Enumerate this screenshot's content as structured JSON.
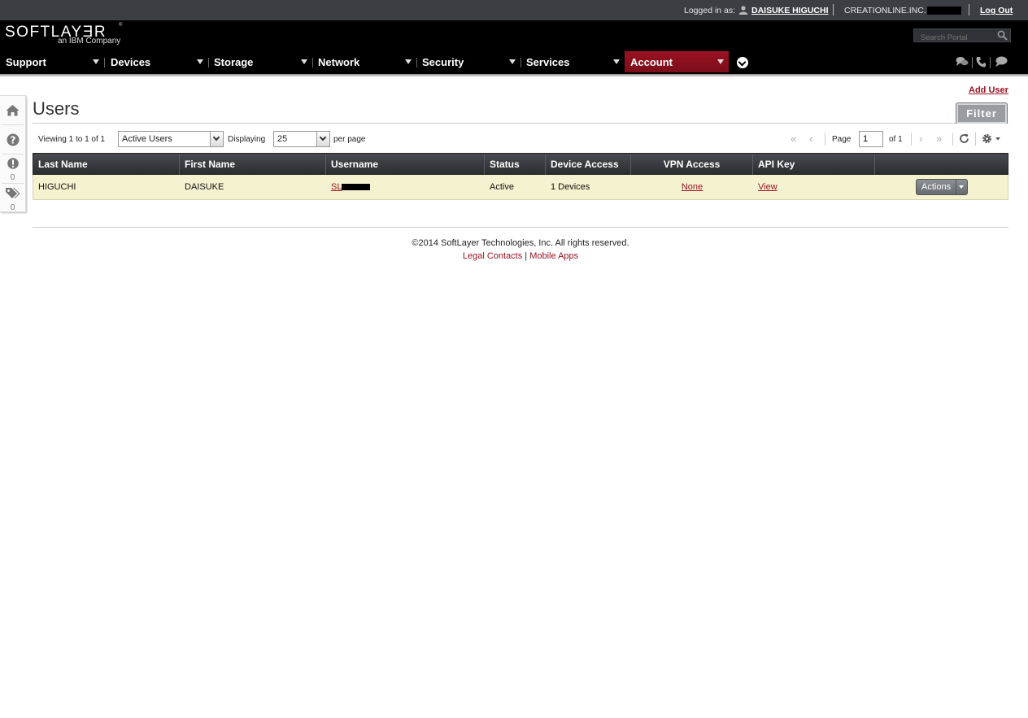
{
  "topbar": {
    "logged_in_label": "Logged in as:",
    "user_name": "DAISUKE HIGUCHI",
    "company": "CREATIONLINE.INC.",
    "logout": "Log Out"
  },
  "brand": {
    "logo": "SOFTLAYƎR",
    "tagline": "an IBM Company",
    "registered": "®"
  },
  "search": {
    "placeholder": "Search Portal"
  },
  "nav": {
    "tabs": [
      {
        "label": "Support"
      },
      {
        "label": "Devices"
      },
      {
        "label": "Storage"
      },
      {
        "label": "Network"
      },
      {
        "label": "Security"
      },
      {
        "label": "Services"
      },
      {
        "label": "Account",
        "active": true
      }
    ],
    "active_color": "#9b1222"
  },
  "side": {
    "alerts_count": "0",
    "tags_count": "0"
  },
  "page": {
    "title": "Users",
    "add_user": "Add User",
    "filter": "Filter"
  },
  "controls": {
    "viewing": "Viewing 1 to 1 of 1",
    "status_filter": "Active Users",
    "displaying": "Displaying",
    "per_page_value": "25",
    "per_page": "per page",
    "page_label": "Page",
    "page_value": "1",
    "of_pages": "of 1"
  },
  "table": {
    "columns": [
      "Last Name",
      "First Name",
      "Username",
      "Status",
      "Device Access",
      "VPN Access",
      "API Key",
      ""
    ],
    "rows": [
      {
        "last_name": "HIGUCHI",
        "first_name": "DAISUKE",
        "username_prefix": "SL",
        "status": "Active",
        "device_access": "1 Devices",
        "vpn_access": "None",
        "api_key": "View",
        "actions": "Actions"
      }
    ]
  },
  "footer": {
    "copyright": "©2014 SoftLayer Technologies, Inc. All rights reserved.",
    "legal": "Legal Contacts",
    "separator": "|",
    "mobile": "Mobile Apps"
  }
}
